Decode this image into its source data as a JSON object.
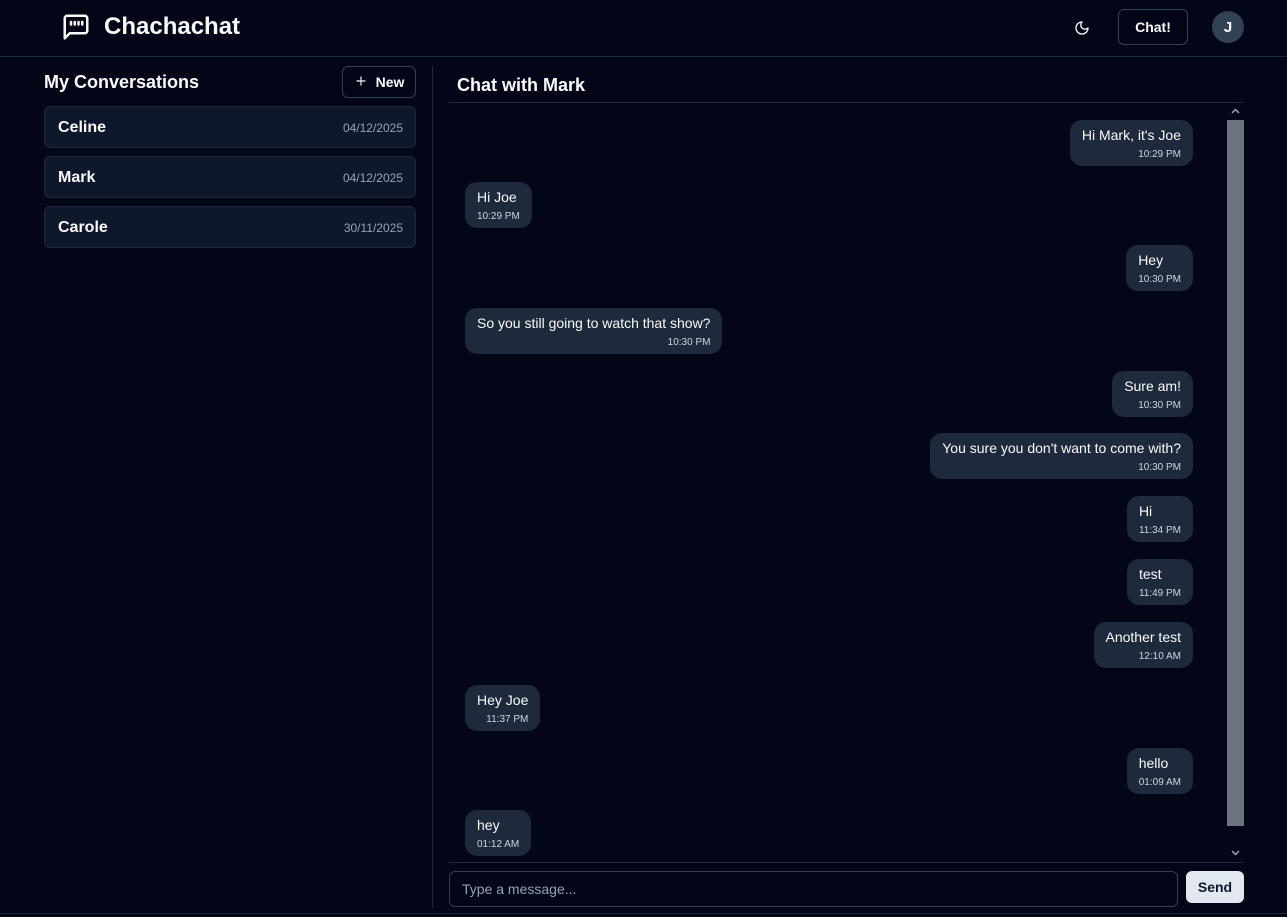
{
  "app": {
    "title": "Chachachat"
  },
  "header": {
    "chat_button": "Chat!",
    "avatar_initial": "J"
  },
  "sidebar": {
    "title": "My Conversations",
    "new_button": "New",
    "conversations": [
      {
        "name": "Celine",
        "date": "04/12/2025"
      },
      {
        "name": "Mark",
        "date": "04/12/2025"
      },
      {
        "name": "Carole",
        "date": "30/11/2025"
      }
    ]
  },
  "chat": {
    "title": "Chat with Mark",
    "messages": [
      {
        "text": "Hi Mark, it's Joe",
        "time": "10:29 PM",
        "direction": "out"
      },
      {
        "text": "Hi Joe",
        "time": "10:29 PM",
        "direction": "in"
      },
      {
        "text": "Hey",
        "time": "10:30 PM",
        "direction": "out"
      },
      {
        "text": "So you still going to watch that show?",
        "time": "10:30 PM",
        "direction": "in"
      },
      {
        "text": "Sure am!",
        "time": "10:30 PM",
        "direction": "out"
      },
      {
        "text": "You sure you don't want to come with?",
        "time": "10:30 PM",
        "direction": "out"
      },
      {
        "text": "Hi",
        "time": "11:34 PM",
        "direction": "out"
      },
      {
        "text": "test",
        "time": "11:49 PM",
        "direction": "out"
      },
      {
        "text": "Another test",
        "time": "12:10 AM",
        "direction": "out"
      },
      {
        "text": "Hey Joe",
        "time": "11:37 PM",
        "direction": "in"
      },
      {
        "text": "hello",
        "time": "01:09 AM",
        "direction": "out"
      },
      {
        "text": "hey",
        "time": "01:12 AM",
        "direction": "in"
      }
    ],
    "input_placeholder": "Type a message...",
    "send_button": "Send"
  },
  "icons": {
    "brand": "message-square-quote-icon",
    "theme": "moon-icon",
    "new": "plus-icon",
    "scroll_up": "chevron-up-icon",
    "scroll_down": "chevron-down-icon"
  },
  "colors": {
    "background": "#020617",
    "panel": "#0f172a",
    "bubble": "#1e293b",
    "border": "#1e293b",
    "text": "#f8fafc",
    "muted": "#94a3b8",
    "send_button": "#e2e8f0"
  }
}
